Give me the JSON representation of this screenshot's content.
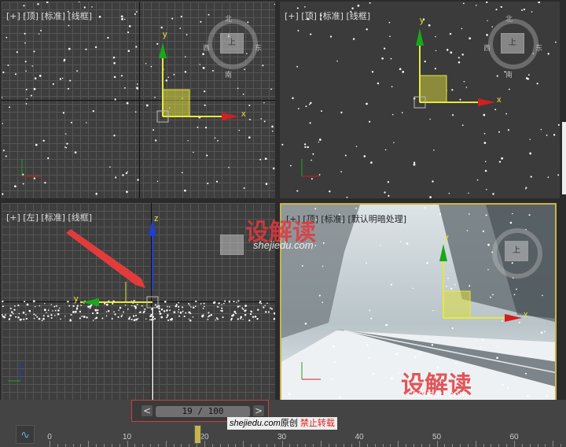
{
  "viewports": {
    "top": {
      "label": "[+] [顶] [标准] [线框]"
    },
    "front": {
      "label": "[+] [顶] [标准] [线框]"
    },
    "left": {
      "label": "[+] [左] [标准] [线框]"
    },
    "perspective": {
      "label": "[+] [顶] [标准] [默认明暗处理]"
    }
  },
  "compass": {
    "north": "北",
    "south": "南",
    "west": "西",
    "east": "东",
    "cube": "上"
  },
  "gizmo": {
    "x": "x",
    "y": "y",
    "z": "z"
  },
  "timeline": {
    "frame_display": "19 / 100",
    "prev": "<",
    "next": ">",
    "ticks": [
      "0",
      "10",
      "20",
      "30",
      "40",
      "50",
      "60"
    ],
    "current_frame": 19
  },
  "watermark": {
    "brand": "设解读",
    "site": "shejiedu.com",
    "credit_site": "shejiedu.com",
    "credit_original": "原创",
    "credit_forbid": "禁止转载"
  },
  "colors": {
    "x_axis": "#d21f1f",
    "y_axis": "#19a81b",
    "z_axis": "#1f3fd2",
    "selection": "#e8e83a",
    "active_border": "#c9b44a"
  }
}
